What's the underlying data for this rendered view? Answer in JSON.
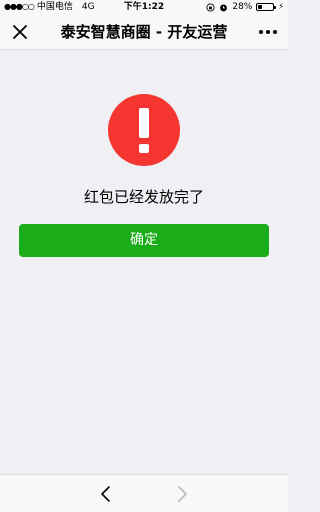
{
  "status_bar": {
    "signal": "●●●○○",
    "carrier": "中国电信",
    "network": "4G",
    "time": "下午1:22",
    "battery_percent": "28%",
    "battery_level": 0.28
  },
  "nav": {
    "title": "泰安智慧商圈 - 开友运营",
    "close_icon": "close-icon",
    "more_icon": "more-icon"
  },
  "main": {
    "alert_icon": "exclamation-icon",
    "alert_color": "#f43530",
    "message": "红包已经发放完了",
    "confirm_label": "确定",
    "confirm_color": "#1aad19"
  },
  "toolbar": {
    "back_icon": "chevron-left-icon",
    "forward_icon": "chevron-right-icon"
  }
}
